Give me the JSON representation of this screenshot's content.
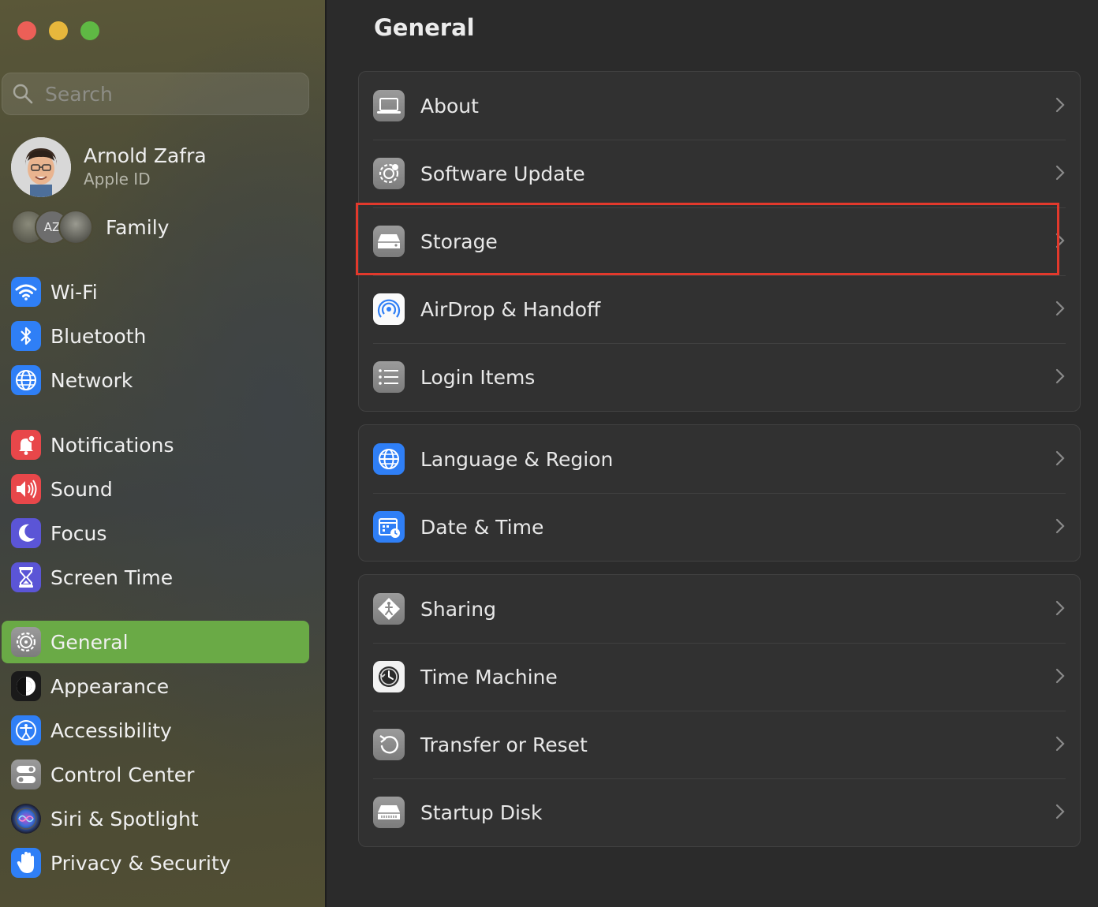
{
  "window": {
    "title": "General"
  },
  "search": {
    "placeholder": "Search"
  },
  "profile": {
    "name": "Arnold Zafra",
    "subtitle": "Apple ID"
  },
  "family": {
    "label": "Family",
    "avatar_initials": "AZ"
  },
  "sidebar": {
    "items": [
      {
        "label": "Wi-Fi",
        "icon": "wifi-icon",
        "color": "#2f7ff6"
      },
      {
        "label": "Bluetooth",
        "icon": "bluetooth-icon",
        "color": "#2f7ff6"
      },
      {
        "label": "Network",
        "icon": "globe-icon",
        "color": "#2f7ff6"
      },
      {
        "label": "Notifications",
        "icon": "bell-icon",
        "color": "#e8474a"
      },
      {
        "label": "Sound",
        "icon": "speaker-icon",
        "color": "#e8474a"
      },
      {
        "label": "Focus",
        "icon": "moon-icon",
        "color": "#5b55d6"
      },
      {
        "label": "Screen Time",
        "icon": "hourglass-icon",
        "color": "#5b55d6"
      },
      {
        "label": "General",
        "icon": "gear-icon",
        "color": "#8e8e8e",
        "selected": true
      },
      {
        "label": "Appearance",
        "icon": "appearance-icon",
        "color": "#1a1a1a"
      },
      {
        "label": "Accessibility",
        "icon": "accessibility-icon",
        "color": "#2f7ff6"
      },
      {
        "label": "Control Center",
        "icon": "toggles-icon",
        "color": "#8e8e8e"
      },
      {
        "label": "Siri & Spotlight",
        "icon": "siri-icon",
        "color": "#2a2a3a"
      },
      {
        "label": "Privacy & Security",
        "icon": "hand-icon",
        "color": "#2f7ff6"
      }
    ]
  },
  "main": {
    "title": "General",
    "groups": [
      [
        {
          "label": "About",
          "icon": "laptop-icon"
        },
        {
          "label": "Software Update",
          "icon": "gear-update-icon"
        },
        {
          "label": "Storage",
          "icon": "drive-icon",
          "highlighted": true
        },
        {
          "label": "AirDrop & Handoff",
          "icon": "airdrop-icon"
        },
        {
          "label": "Login Items",
          "icon": "list-icon"
        }
      ],
      [
        {
          "label": "Language & Region",
          "icon": "globe-icon"
        },
        {
          "label": "Date & Time",
          "icon": "calendar-clock-icon"
        }
      ],
      [
        {
          "label": "Sharing",
          "icon": "sharing-icon"
        },
        {
          "label": "Time Machine",
          "icon": "time-machine-icon"
        },
        {
          "label": "Transfer or Reset",
          "icon": "reset-icon"
        },
        {
          "label": "Startup Disk",
          "icon": "disk-icon"
        }
      ]
    ]
  },
  "colors": {
    "selection": "#6aaa46",
    "highlight_box": "#e2392c",
    "accent_blue": "#2f7ff6"
  }
}
